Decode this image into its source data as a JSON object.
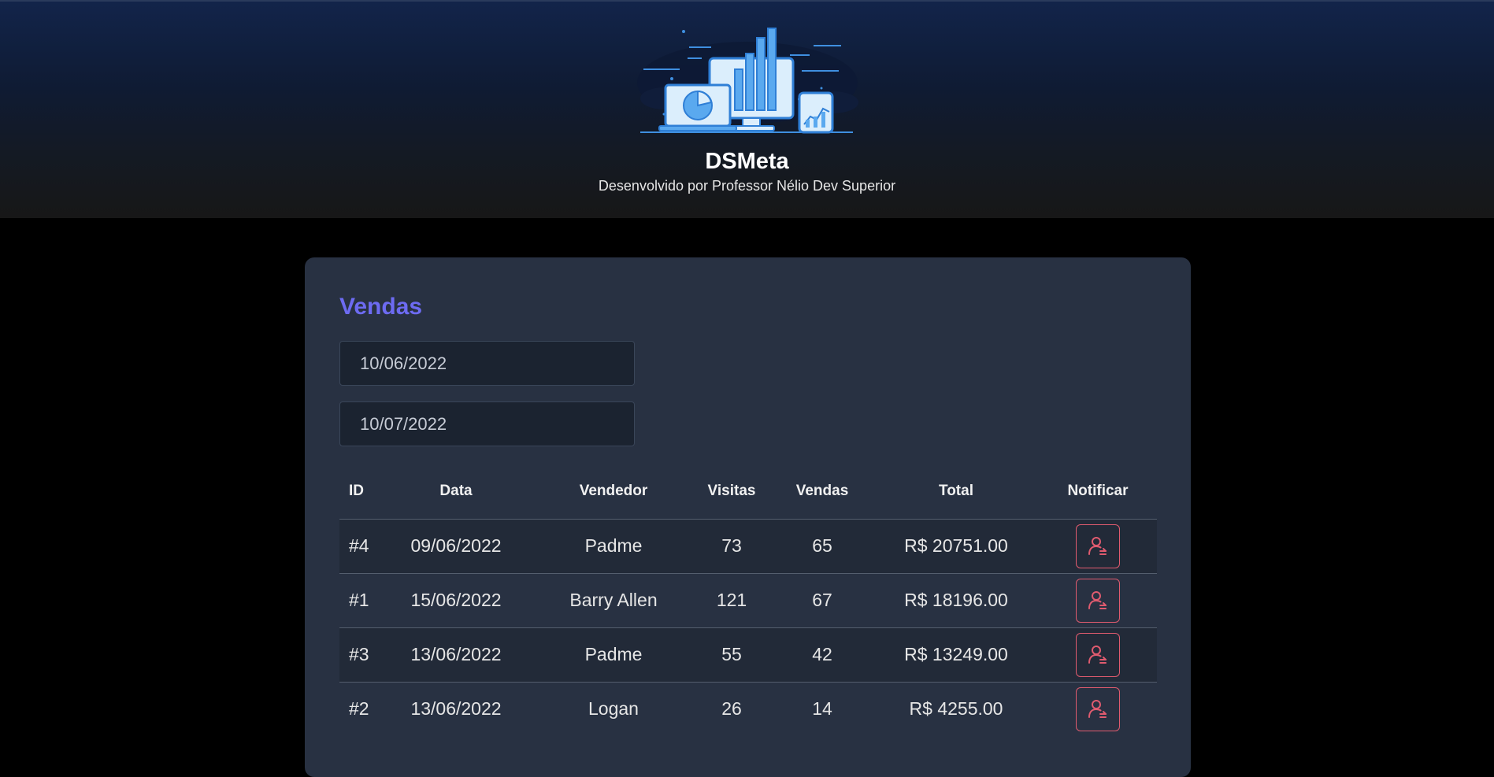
{
  "header": {
    "title": "DSMeta",
    "subtitle": "Desenvolvido por Professor Nélio Dev Superior"
  },
  "sales_card": {
    "title": "Vendas",
    "min_date": "10/06/2022",
    "max_date": "10/07/2022"
  },
  "table": {
    "columns": [
      "ID",
      "Data",
      "Vendedor",
      "Visitas",
      "Vendas",
      "Total",
      "Notificar"
    ],
    "rows": [
      {
        "id": "#4",
        "date": "09/06/2022",
        "seller": "Padme",
        "visits": "73",
        "deals": "65",
        "amount": "R$ 20751.00"
      },
      {
        "id": "#1",
        "date": "15/06/2022",
        "seller": "Barry Allen",
        "visits": "121",
        "deals": "67",
        "amount": "R$ 18196.00"
      },
      {
        "id": "#3",
        "date": "13/06/2022",
        "seller": "Padme",
        "visits": "55",
        "deals": "42",
        "amount": "R$ 13249.00"
      },
      {
        "id": "#2",
        "date": "13/06/2022",
        "seller": "Logan",
        "visits": "26",
        "deals": "14",
        "amount": "R$ 4255.00"
      }
    ]
  },
  "colors": {
    "accent": "#6d6bf2",
    "notify": "#e05b6f",
    "card": "#283142",
    "page": "#000000"
  },
  "icons": {
    "notify": "user-notify-icon",
    "logo": "dashboard-devices-logo"
  }
}
